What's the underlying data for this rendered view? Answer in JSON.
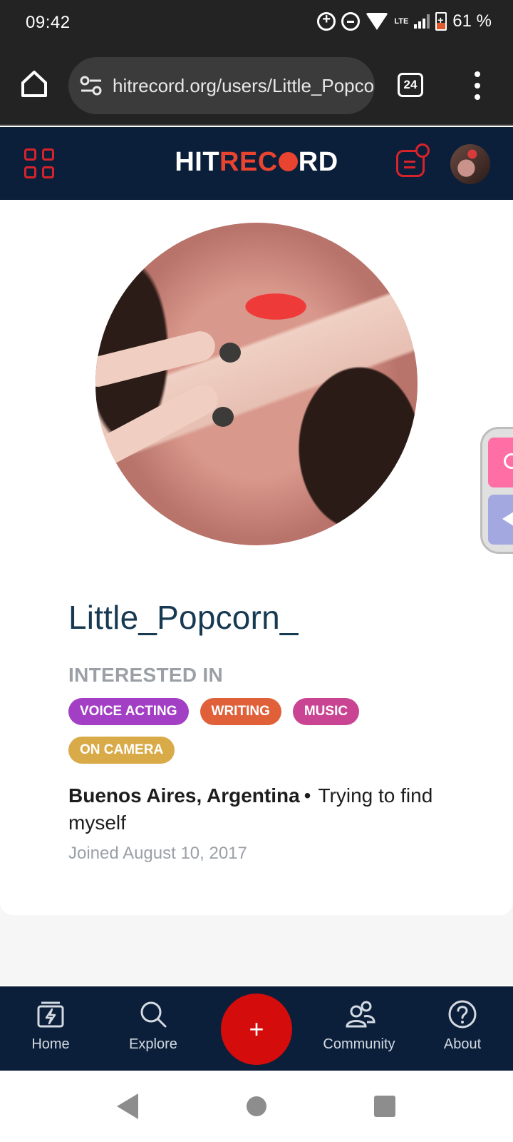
{
  "status_bar": {
    "time": "09:42",
    "network": "LTE",
    "battery": "61 %",
    "icons": [
      "sync-icon",
      "dnd-icon",
      "wifi-icon",
      "signal-icon",
      "battery-icon"
    ]
  },
  "browser": {
    "url": "hitrecord.org/users/Little_Popcorn_",
    "tab_count": "24",
    "icons": [
      "home-icon",
      "tune-icon",
      "tabs-icon",
      "more-vert-icon"
    ]
  },
  "site_header": {
    "logo_left": "HIT",
    "logo_red": "REC",
    "logo_right": "RD",
    "icons": [
      "apps-grid-icon",
      "notifications-icon",
      "avatar"
    ]
  },
  "profile": {
    "username": "Little_Popcorn_",
    "interests_heading": "INTERESTED IN",
    "interests": [
      {
        "label": "VOICE ACTING",
        "color": "#a23fc4"
      },
      {
        "label": "WRITING",
        "color": "#e0603a"
      },
      {
        "label": "MUSIC",
        "color": "#c94492"
      },
      {
        "label": "ON CAMERA",
        "color": "#d9aa48"
      }
    ],
    "location": "Buenos Aires, Argentina",
    "separator": "•",
    "bio": "Trying to find myself",
    "joined": "Joined August 10, 2017"
  },
  "bottom_nav": {
    "items": [
      {
        "label": "Home",
        "icon": "home-bolt-icon"
      },
      {
        "label": "Explore",
        "icon": "search-icon"
      },
      {
        "label": "Community",
        "icon": "community-icon"
      },
      {
        "label": "About",
        "icon": "help-icon"
      }
    ],
    "add_label": "+"
  },
  "colors": {
    "header_bg": "#0c1f3a",
    "accent_red": "#d8232a",
    "username": "#173a52"
  }
}
